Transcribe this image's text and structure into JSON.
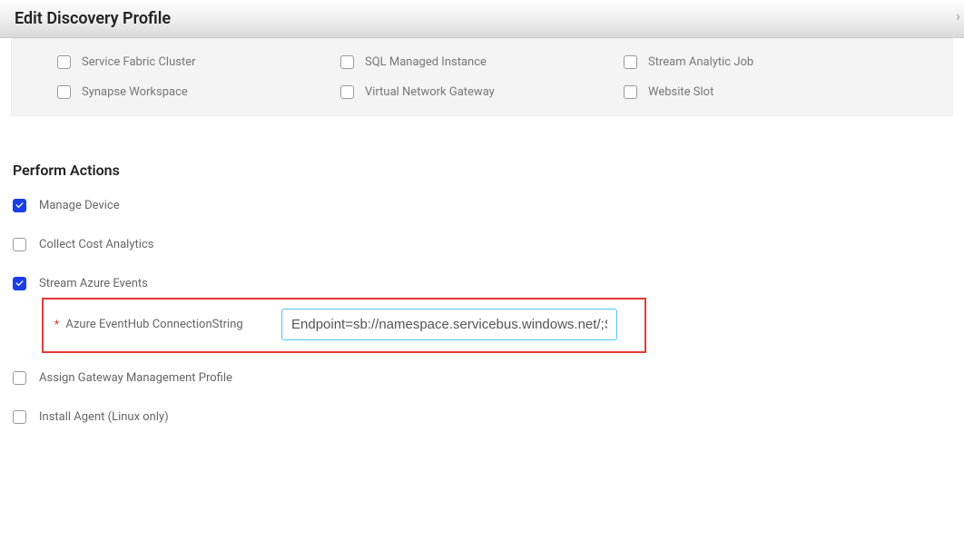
{
  "header": {
    "title": "Edit Discovery Profile"
  },
  "services": {
    "row1": [
      {
        "label": "Service Fabric Cluster",
        "checked": false
      },
      {
        "label": "SQL Managed Instance",
        "checked": false
      },
      {
        "label": "Stream Analytic Job",
        "checked": false
      }
    ],
    "row2": [
      {
        "label": "Synapse Workspace",
        "checked": false
      },
      {
        "label": "Virtual Network Gateway",
        "checked": false
      },
      {
        "label": "Website Slot",
        "checked": false
      }
    ]
  },
  "actions": {
    "section_title": "Perform Actions",
    "items": {
      "manage_device": {
        "label": "Manage Device",
        "checked": true
      },
      "collect_cost": {
        "label": "Collect Cost Analytics",
        "checked": false
      },
      "stream_events": {
        "label": "Stream Azure Events",
        "checked": true
      },
      "assign_gateway": {
        "label": "Assign Gateway Management Profile",
        "checked": false
      },
      "install_agent": {
        "label": "Install Agent (Linux only)",
        "checked": false
      }
    },
    "eventhub": {
      "label": "Azure EventHub ConnectionString",
      "value": "Endpoint=sb://namespace.servicebus.windows.net/;SharedAccessKeyName=..."
    }
  }
}
